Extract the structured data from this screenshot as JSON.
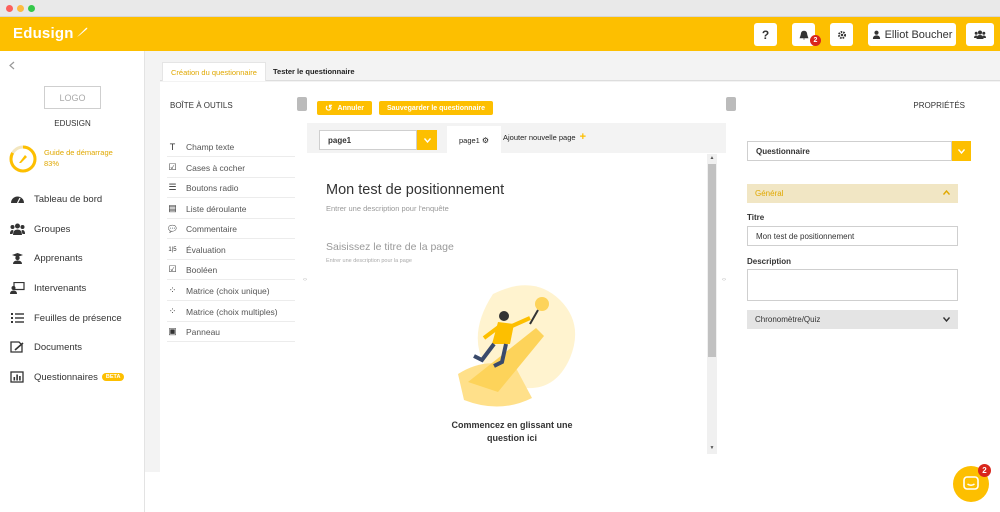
{
  "header": {
    "brand": "Edusign",
    "help_label": "?",
    "notifications_count": "2",
    "user_name": "Elliot Boucher"
  },
  "sidebar": {
    "logo_placeholder": "LOGO",
    "org_name": "EDUSIGN",
    "guide_label": "Guide de démarrage",
    "guide_percent": "83%",
    "guide_progress": 0.83,
    "items": [
      {
        "label": "Tableau de bord",
        "icon": "dashboard-icon"
      },
      {
        "label": "Groupes",
        "icon": "groups-icon"
      },
      {
        "label": "Apprenants",
        "icon": "students-icon"
      },
      {
        "label": "Intervenants",
        "icon": "teachers-icon"
      },
      {
        "label": "Feuilles de présence",
        "icon": "list-icon"
      },
      {
        "label": "Documents",
        "icon": "documents-icon"
      },
      {
        "label": "Questionnaires",
        "icon": "chart-icon",
        "badge": "BETA"
      }
    ]
  },
  "tabs": {
    "creation": "Création du questionnaire",
    "test": "Tester le questionnaire"
  },
  "toolbox": {
    "title": "BOÎTE À OUTILS",
    "tools": [
      {
        "label": "Champ texte",
        "icon": "T"
      },
      {
        "label": "Cases à cocher",
        "icon": "☑"
      },
      {
        "label": "Boutons radio",
        "icon": "☰"
      },
      {
        "label": "Liste déroulante",
        "icon": "▤"
      },
      {
        "label": "Commentaire",
        "icon": "💬"
      },
      {
        "label": "Évaluation",
        "icon": "1|5"
      },
      {
        "label": "Booléen",
        "icon": "☑"
      },
      {
        "label": "Matrice (choix unique)",
        "icon": "⁘"
      },
      {
        "label": "Matrice (choix multiples)",
        "icon": "⁘"
      },
      {
        "label": "Panneau",
        "icon": "▣"
      }
    ]
  },
  "editor": {
    "undo_label": "Annuler",
    "save_label": "Sauvegarder le questionnaire",
    "page_select": "page1",
    "page_tab": "page1",
    "add_page": "Ajouter nouvelle page",
    "survey_title": "Mon test de positionnement",
    "survey_desc": "Entrer une description pour l'enquête",
    "page_title_placeholder": "Saisissez le titre de la page",
    "page_desc_placeholder": "Entrer une description pour la page",
    "drop_hint_line1": "Commencez en glissant une",
    "drop_hint_line2": "question ici"
  },
  "properties": {
    "title": "PROPRIÉTÉS",
    "object_select": "Questionnaire",
    "section_general": "Général",
    "titre_label": "Titre",
    "titre_value": "Mon test de positionnement",
    "description_label": "Description",
    "timer_section": "Chronomètre/Quiz"
  },
  "chat": {
    "badge": "2"
  },
  "colors": {
    "accent": "#fdbf00",
    "badge": "#d9261c"
  }
}
